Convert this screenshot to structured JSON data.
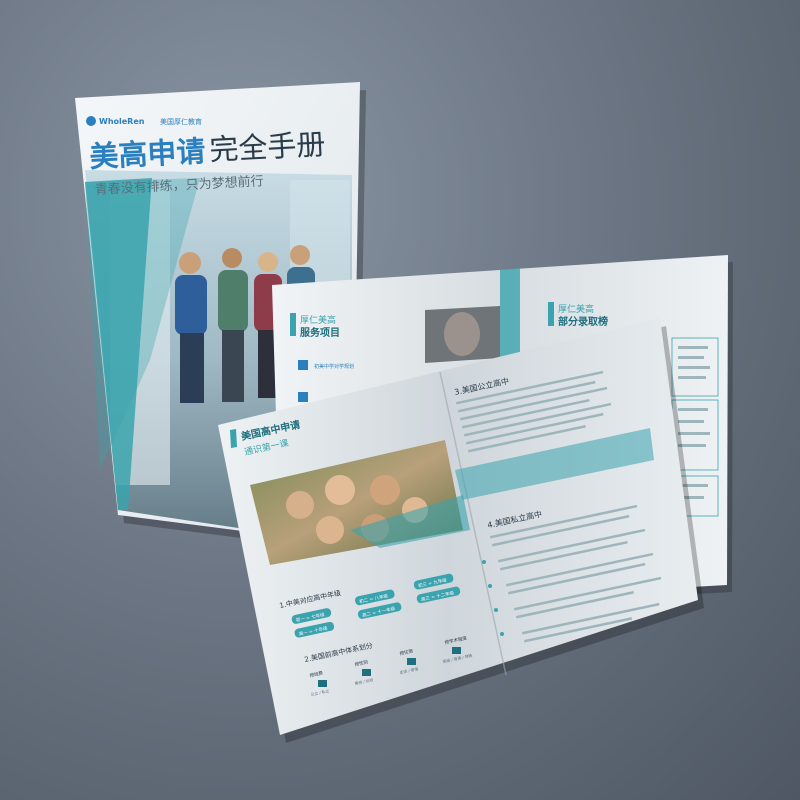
{
  "cover": {
    "logo_brand": "WholeRen",
    "logo_tag": "美国厚仁教育",
    "title_main": "美高申请",
    "title_rest": "完全手册",
    "subtitle": "青春没有排练，只为梦想前行"
  },
  "back_spread": {
    "left_heading_1": "厚仁美高",
    "left_heading_2": "服务项目",
    "service_1": "初美中学对学规划",
    "right_heading_1": "厚仁美高",
    "right_heading_2": "部分录取榜"
  },
  "front_spread": {
    "left_heading_1": "美国高中申请",
    "left_heading_2": "通识第一课",
    "section_1": "1.中美对应高中年级",
    "grades": [
      "初一 = 七年级",
      "初二 = 八年级",
      "初三 = 九年级",
      "高一 = 十年级",
      "高二 = 十一年级",
      "高三 = 十二年级"
    ],
    "section_2": "2.美国前高中体系划分",
    "systems": [
      "按经费",
      "按性别",
      "按住宿",
      "按学术程度"
    ],
    "system_notes": [
      "公立 / 私立",
      "男校 / 女校",
      "走读 / 寄宿",
      "高级 / 普通 / 特殊"
    ],
    "section_3": "3.美国公立高中",
    "section_4": "4.美国私立高中"
  },
  "colors": {
    "accent": "#3aa3ad",
    "accent_dark": "#1f6f7e",
    "title_blue": "#2a7fbf",
    "background": "#6c7684"
  }
}
